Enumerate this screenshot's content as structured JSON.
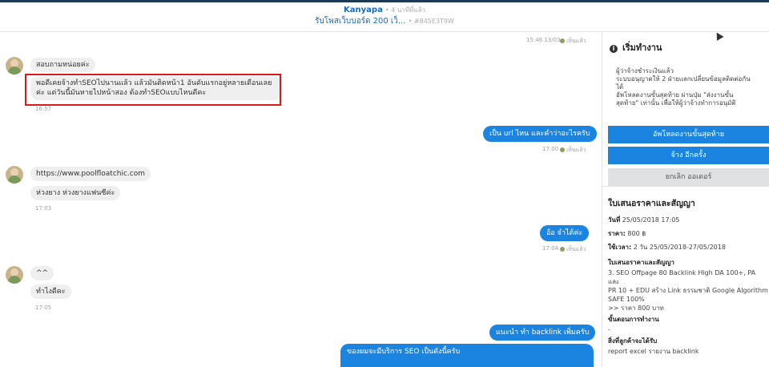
{
  "header": {
    "name": "Kanyapa",
    "ago": "• 4 นาทีที่แล้ว",
    "job_title": "รับโพสเว็บบอร์ด 200 เว็...",
    "order_code": "• #845E3T9W"
  },
  "chat": {
    "messages": [
      {
        "time": "15:46 13/03",
        "read": "เห็นแล้ว"
      },
      {
        "lines": [
          "สอบถามหน่อยค่ะ"
        ]
      },
      {
        "lines": [
          "พอดีเคยจ้างทำSEOไปนานแล้ว แล้วมันติดหน้า1 อันดับแรกอยู่หลายเดือนเลย",
          "ค่ะ แต่วันนี้มันหายไปหน้าสอง ต้องทำSEOแบบไหนดีคะ"
        ],
        "time": "16:57"
      },
      {
        "text": "เป็น url ไหน และคำว่าอะไรครับ",
        "time": "17:00",
        "read": "เห็นแล้ว"
      },
      {
        "lines": [
          "https://www.poolfloatchic.com"
        ]
      },
      {
        "lines": [
          "ห่วงยาง ห่วงยางแฟนซีค่ะ"
        ],
        "time": "17:03"
      },
      {
        "text": "อ้อ จำได้ค่ะ",
        "time": "17:04",
        "read": "เห็นแล้ว"
      },
      {
        "lines": [
          "^^"
        ]
      },
      {
        "lines": [
          "ทำไงดีคะ"
        ],
        "time": "17:05"
      },
      {
        "text": "แนะนำ ทำ backlink เพิ่มครับ"
      },
      {
        "text": "ของผมจะมีบริการ SEO เป็นดังนี้ครับ"
      }
    ]
  },
  "panel": {
    "title": "เริ่มทำงาน",
    "steps": [
      "ผู้ว่าจ้างชำระเงินแล้ว",
      "ระบบอนุญาตให้ 2 ฝ่ายแลกเปลี่ยนข้อมูลติดต่อกัน",
      "ได้",
      "อัพโหลดงานขั้นสุดท้าย ผ่านปุ่ม \"ส่งงานขั้น",
      "สุดท้าย\" เท่านั้น เพื่อให้ผู้ว่าจ้างทำการอนุมัติ"
    ],
    "btn_upload": "อัพโหลดงานขั้นสุดท้าย",
    "btn_rehire": "จ้าง อีกครั้ง",
    "btn_cancel": "ยกเลิก ออเดอร์",
    "quote_title": "ใบเสนอราคาและสัญญา",
    "date_label": "วันที่",
    "date_value": "25/05/2018 17:05",
    "price_label": "ราคา:",
    "price_value": "800 ฿",
    "duration_label": "ใช้เวลา:",
    "duration_value": "2 วัน 25/05/2018-27/05/2018",
    "contract_label": "ใบเสนอราคาและสัญญา",
    "contract_lines": [
      "3. SEO Offpage 80 Backlink High DA 100+, PA และ",
      "PR 10 + EDU สร้าง Link ธรรมชาติ Google Algorithm",
      "SAFE 100%",
      ">> ราคา 800 บาท"
    ],
    "steps_label": "ขั้นตอนการทำงาน",
    "steps_value": "-",
    "receive_label": "สิ่งที่ลูกค้าจะได้รับ",
    "receive_value": "report excel รายงาน backlink"
  },
  "icons": {
    "info": "info-icon",
    "cursor": "mouse-cursor-icon"
  },
  "colors": {
    "accent": "#1a84e0",
    "highlight": "#d9191e"
  }
}
